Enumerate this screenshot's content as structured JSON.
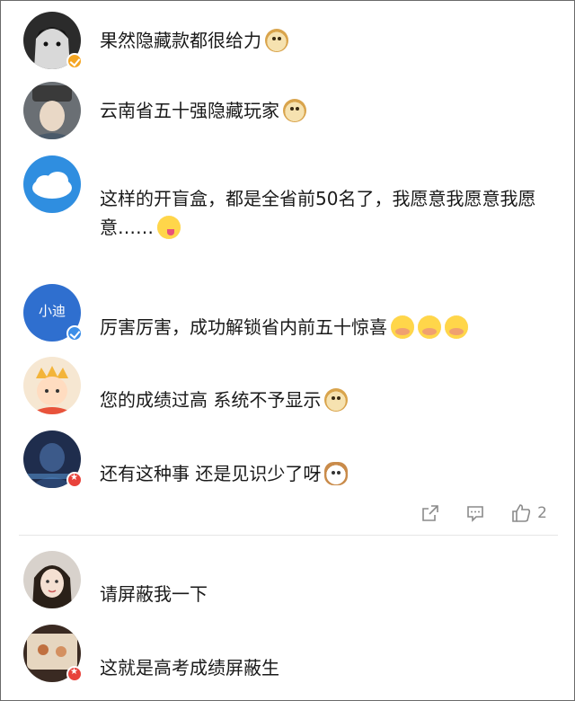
{
  "comments": [
    {
      "text": "果然隐藏款都很给力",
      "emoji": "doge-emoji",
      "badge": "verified-gold"
    },
    {
      "text": "云南省五十强隐藏玩家",
      "emoji": "doge-emoji",
      "badge": "none"
    },
    {
      "text": "这样的开盲盒，都是全省前50名了，我愿意我愿意我愿意……",
      "emoji": "licking-lips-emoji",
      "badge": "none"
    },
    {
      "text": "厉害厉害，成功解锁省内前五十惊喜",
      "emoji": "shy-emoji",
      "emoji_count": 3,
      "badge": "verified-blue",
      "avatar_label": "小迪"
    },
    {
      "text": "您的成绩过高 系统不予显示",
      "emoji": "doge-emoji",
      "badge": "none"
    },
    {
      "text": "还有这种事 还是见识少了呀",
      "emoji": "cat-emoji",
      "badge": "red-star"
    },
    {
      "text": "请屏蔽我一下",
      "badge": "none"
    },
    {
      "text": "这就是高考成绩屏蔽生",
      "badge": "red-star"
    }
  ],
  "actions": {
    "like_count": "2",
    "icons": [
      "share-icon",
      "comment-icon",
      "thumbs-up-icon"
    ]
  },
  "colors": {
    "text": "#1a1a1a",
    "muted": "#8a8a8a",
    "verified_gold": "#f5a623",
    "verified_blue": "#3b8ee8",
    "red_badge": "#e8423b"
  }
}
